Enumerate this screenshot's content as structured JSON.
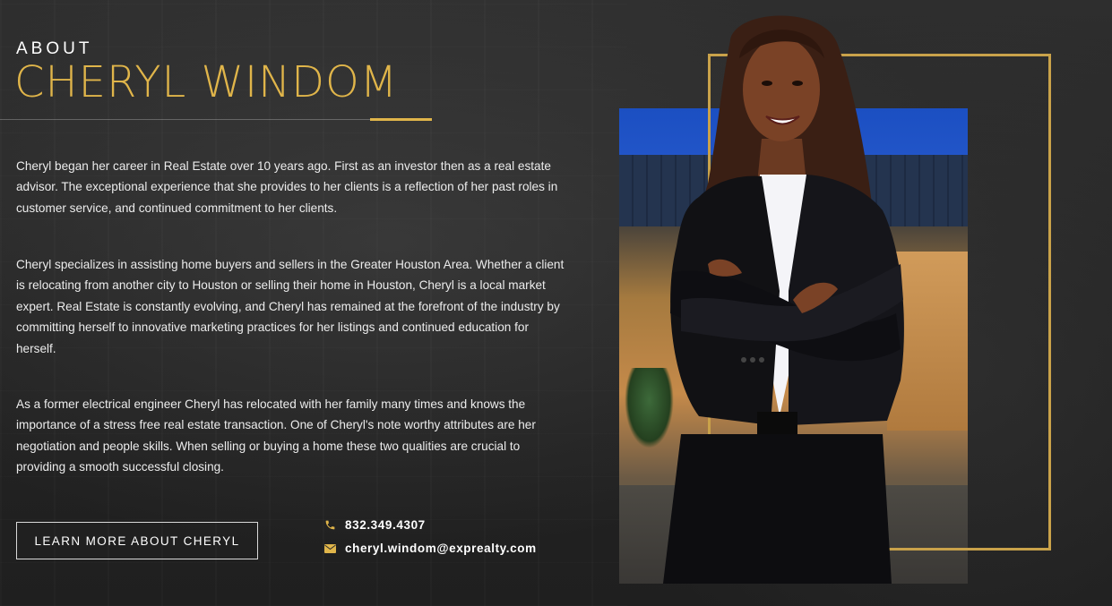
{
  "header": {
    "about_label": "ABOUT",
    "name": "CHERYL WINDOM"
  },
  "bio": {
    "paragraph_1": "Cheryl began her career in Real Estate over 10 years ago. First as an investor then as a real estate advisor. The exceptional experience that she provides to her clients is a reflection of her past roles in customer service, and continued commitment to her clients.",
    "paragraph_2": "Cheryl specializes in assisting home buyers and sellers in the Greater Houston Area. Whether a client is relocating from another city to Houston or selling their home in Houston, Cheryl is a local market expert. Real Estate is constantly evolving, and Cheryl has remained at the forefront of the industry by committing herself to innovative marketing practices for her listings and continued education for herself.",
    "paragraph_3": "As a former electrical engineer Cheryl has relocated with her family many times and knows the importance of a stress free real estate transaction. One of Cheryl's note worthy attributes are her negotiation and people skills. When selling or buying a home these two qualities are crucial to providing a smooth successful closing."
  },
  "cta": {
    "learn_more_label": "LEARN MORE ABOUT CHERYL"
  },
  "contact": {
    "phone": "832.349.4307",
    "phone_icon": "phone-icon",
    "email": "cheryl.windom@exprealty.com",
    "email_icon": "envelope-icon"
  },
  "colors": {
    "accent_gold": "#e0b54a",
    "background": "#262626",
    "text": "#ececec"
  }
}
